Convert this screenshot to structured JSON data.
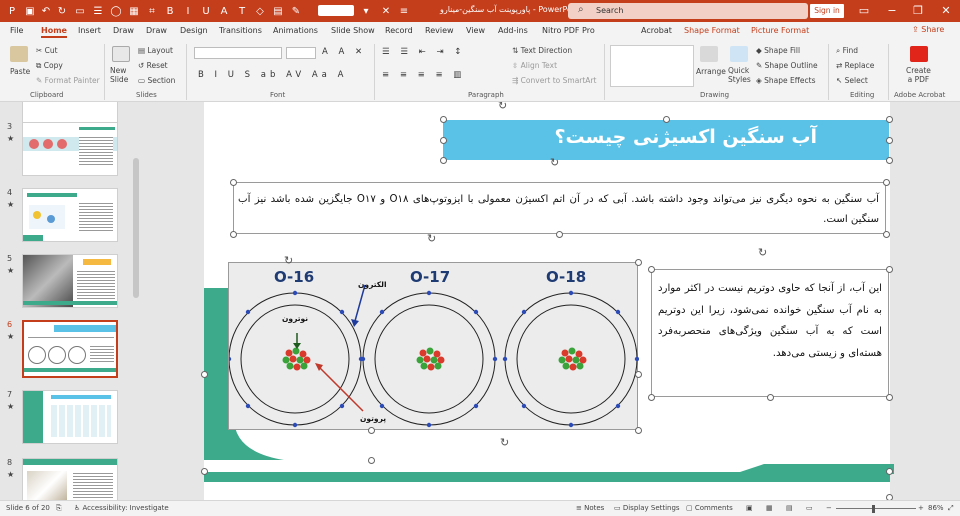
{
  "titlebar": {
    "title": "پاورپوینت آب سنگین-مینارو  -  PowerPoint",
    "search_placeholder": "Search",
    "signin": "Sign in",
    "bg_color": "#c43e1c"
  },
  "menu": {
    "tabs": [
      "File",
      "Home",
      "Insert",
      "Draw",
      "Draw",
      "Design",
      "Transitions",
      "Animations",
      "Slide Show",
      "Record",
      "Review",
      "View",
      "Add-ins",
      "Nitro PDF Pro",
      "Acrobat",
      "Shape Format",
      "Picture Format"
    ],
    "active": "Home",
    "share": "Share"
  },
  "ribbon": {
    "paste": "Paste",
    "cut": "Cut",
    "copy": "Copy",
    "format_painter": "Format Painter",
    "new_slide": "New\nSlide",
    "layout": "Layout",
    "reset": "Reset",
    "section": "Section",
    "text_direction": "Text Direction",
    "align_text": "Align Text",
    "convert_smartart": "Convert to SmartArt",
    "arrange": "Arrange",
    "quick_styles": "Quick\nStyles",
    "shape_fill": "Shape Fill",
    "shape_outline": "Shape Outline",
    "shape_effects": "Shape Effects",
    "find": "Find",
    "replace": "Replace",
    "select": "Select",
    "create_pdf": "Create\na PDF",
    "groups": {
      "clipboard": "Clipboard",
      "slides": "Slides",
      "font": "Font",
      "paragraph": "Paragraph",
      "drawing": "Drawing",
      "editing": "Editing",
      "adobe": "Adobe Acrobat"
    }
  },
  "thumbnails": [
    {
      "num": "3",
      "star": "★"
    },
    {
      "num": "4",
      "star": "★"
    },
    {
      "num": "5",
      "star": "★"
    },
    {
      "num": "6",
      "star": "★"
    },
    {
      "num": "7",
      "star": "★"
    },
    {
      "num": "8",
      "star": "★"
    }
  ],
  "slide": {
    "title": "آب سنگین اکسیژنی چیست؟",
    "paragraph1": "آب سنگین به نحوه دیگری نیز می‌تواند وجود داشته باشد. آبی که در آن اتم اکسیژن معمولی با ایزوتوپ‌های O۱۸ و O۱۷ جایگزین شده باشد نیز آب سنگین است.",
    "paragraph2": "این آب، از آنجا که حاوی دوتریم نیست در اکثر موارد به نام آب سنگین خوانده نمی‌شود، زیرا این دوتریم است که به آب سنگین ویژگی‌های منحصربه‌فرد هسته‌ای و زیستی می‌دهد.",
    "atoms": [
      "O-16",
      "O-17",
      "O-18"
    ],
    "label_electron": "الکترون",
    "label_neutron": "نوترون",
    "label_proton": "پروتون",
    "title_color": "#5bc2e7",
    "accent_green": "#3daa8c"
  },
  "statusbar": {
    "slide_info": "Slide 6 of 20",
    "accessibility": "Accessibility: Investigate",
    "notes": "Notes",
    "display_settings": "Display Settings",
    "comments": "Comments",
    "zoom": "86%"
  }
}
